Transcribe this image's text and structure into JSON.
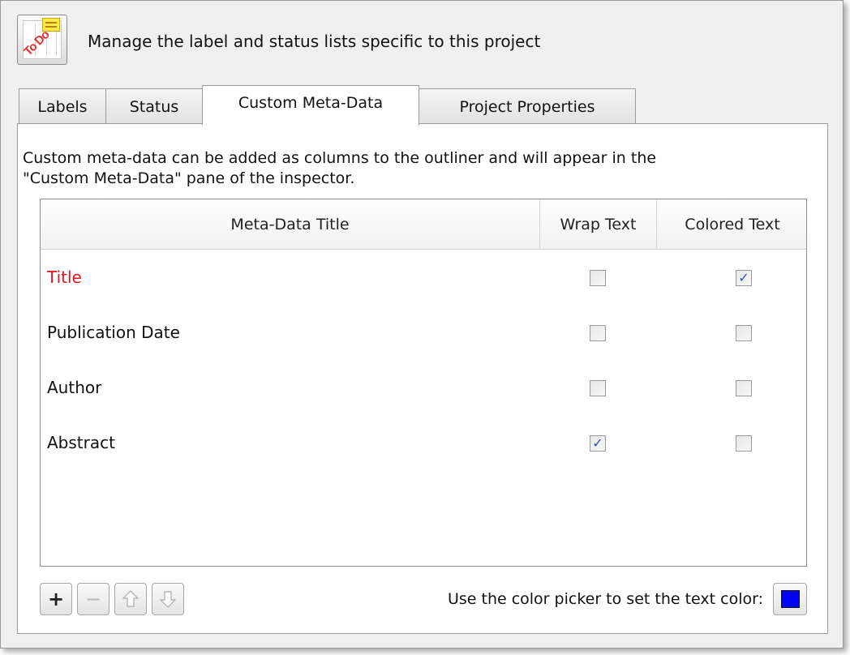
{
  "header": {
    "text": "Manage the label and status lists specific to this project",
    "icon": "todo-list-icon",
    "icon_stamp": "To Do"
  },
  "tabs": [
    {
      "label": "Labels",
      "active": false
    },
    {
      "label": "Status",
      "active": false
    },
    {
      "label": "Custom Meta-Data",
      "active": true
    },
    {
      "label": "Project Properties",
      "active": false
    }
  ],
  "panel": {
    "description_line1": "Custom meta-data can be added as columns to the outliner and will appear in the",
    "description_line2": "\"Custom Meta-Data\" pane of the inspector."
  },
  "table": {
    "columns": [
      "Meta-Data Title",
      "Wrap Text",
      "Colored Text"
    ],
    "rows": [
      {
        "title": "Title",
        "color": "#e8141b",
        "wrap_text": false,
        "colored_text": true
      },
      {
        "title": "Publication Date",
        "color": "#111111",
        "wrap_text": false,
        "colored_text": false
      },
      {
        "title": "Author",
        "color": "#111111",
        "wrap_text": false,
        "colored_text": false
      },
      {
        "title": "Abstract",
        "color": "#111111",
        "wrap_text": true,
        "colored_text": false
      }
    ]
  },
  "toolbar": {
    "add_label": "+",
    "remove_label": "−",
    "move_up_icon": "arrow-up-icon",
    "move_down_icon": "arrow-down-icon"
  },
  "color_picker": {
    "label": "Use the color picker to set the text color:",
    "color": "#0000ff"
  }
}
